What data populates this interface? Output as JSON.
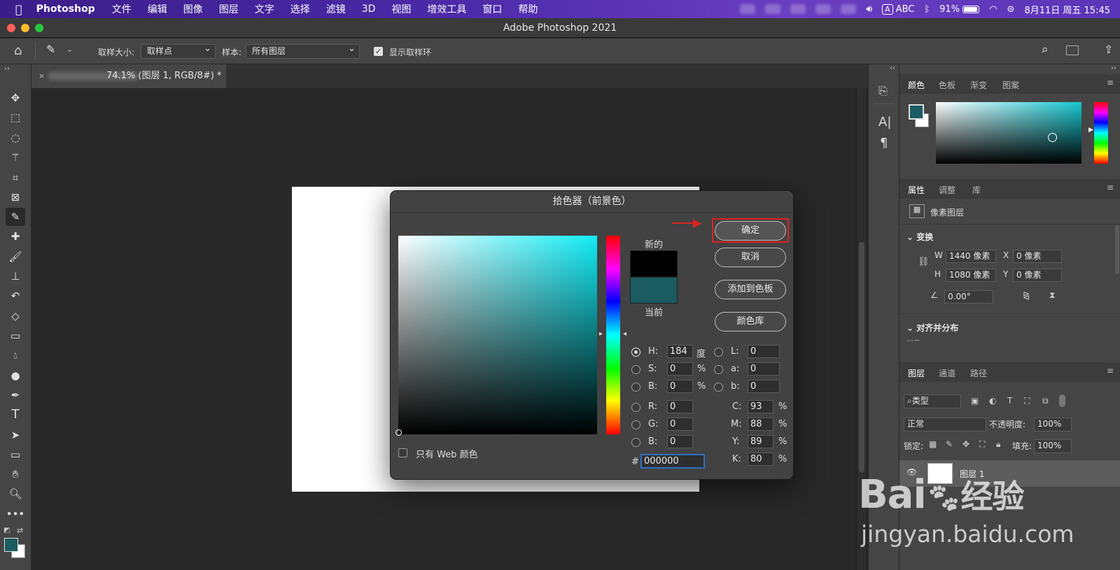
{
  "menubar": {
    "app": "Photoshop",
    "items": [
      "文件",
      "编辑",
      "图像",
      "图层",
      "文字",
      "选择",
      "滤镜",
      "3D",
      "视图",
      "增效工具",
      "窗口",
      "帮助"
    ],
    "input_label": "ABC",
    "input_badge": "A",
    "battery": "91%",
    "datetime": "8月11日 周五  15:45"
  },
  "window": {
    "title": "Adobe Photoshop 2021"
  },
  "options": {
    "sample_size_label": "取样大小:",
    "sample_size_value": "取样点",
    "sample_label": "样本:",
    "sample_value": "所有图层",
    "show_ring_label": "显示取样环",
    "show_ring_checked": true
  },
  "document_tab": {
    "title": "74.1% (图层 1, RGB/8#) *"
  },
  "dialog": {
    "title": "拾色器（前景色）",
    "new_label": "新的",
    "current_label": "当前",
    "new_color": "#000000",
    "current_color": "#1a5c60",
    "ok": "确定",
    "cancel": "取消",
    "add_swatch": "添加到色板",
    "libraries": "颜色库",
    "web_only": "只有 Web 颜色",
    "fields": {
      "H": {
        "label": "H:",
        "value": "184",
        "unit": "度"
      },
      "S": {
        "label": "S:",
        "value": "0",
        "unit": "%"
      },
      "Bv": {
        "label": "B:",
        "value": "0",
        "unit": "%"
      },
      "R": {
        "label": "R:",
        "value": "0"
      },
      "G": {
        "label": "G:",
        "value": "0"
      },
      "Bc": {
        "label": "B:",
        "value": "0"
      },
      "L": {
        "label": "L:",
        "value": "0"
      },
      "a": {
        "label": "a:",
        "value": "0"
      },
      "b": {
        "label": "b:",
        "value": "0"
      },
      "C": {
        "label": "C:",
        "value": "93",
        "unit": "%"
      },
      "M": {
        "label": "M:",
        "value": "88",
        "unit": "%"
      },
      "Y": {
        "label": "Y:",
        "value": "89",
        "unit": "%"
      },
      "K": {
        "label": "K:",
        "value": "80",
        "unit": "%"
      }
    },
    "hex_label": "#",
    "hex_value": "000000"
  },
  "color_panel": {
    "tabs": [
      "颜色",
      "色板",
      "渐变",
      "图案"
    ],
    "foreground": "#1a5c60"
  },
  "properties_panel": {
    "tabs": [
      "属性",
      "调整",
      "库"
    ],
    "type": "像素图层",
    "transform_label": "变换",
    "w_label": "W",
    "w_value": "1440 像素",
    "h_label": "H",
    "h_value": "1080 像素",
    "x_label": "X",
    "x_value": "0 像素",
    "y_label": "Y",
    "y_value": "0 像素",
    "angle_value": "0.00°",
    "align_label": "对齐并分布",
    "align_sub": "对齐:"
  },
  "layers_panel": {
    "tabs": [
      "图层",
      "通道",
      "路径"
    ],
    "filter": "类型",
    "blend_mode": "正常",
    "opacity_label": "不透明度:",
    "opacity_value": "100%",
    "lock_label": "锁定:",
    "fill_label": "填充:",
    "fill_value": "100%",
    "layer_name": "图层 1"
  },
  "watermark": {
    "brand_left": "Bai",
    "brand_mid": "经验",
    "url": "jingyan.baidu.com"
  }
}
